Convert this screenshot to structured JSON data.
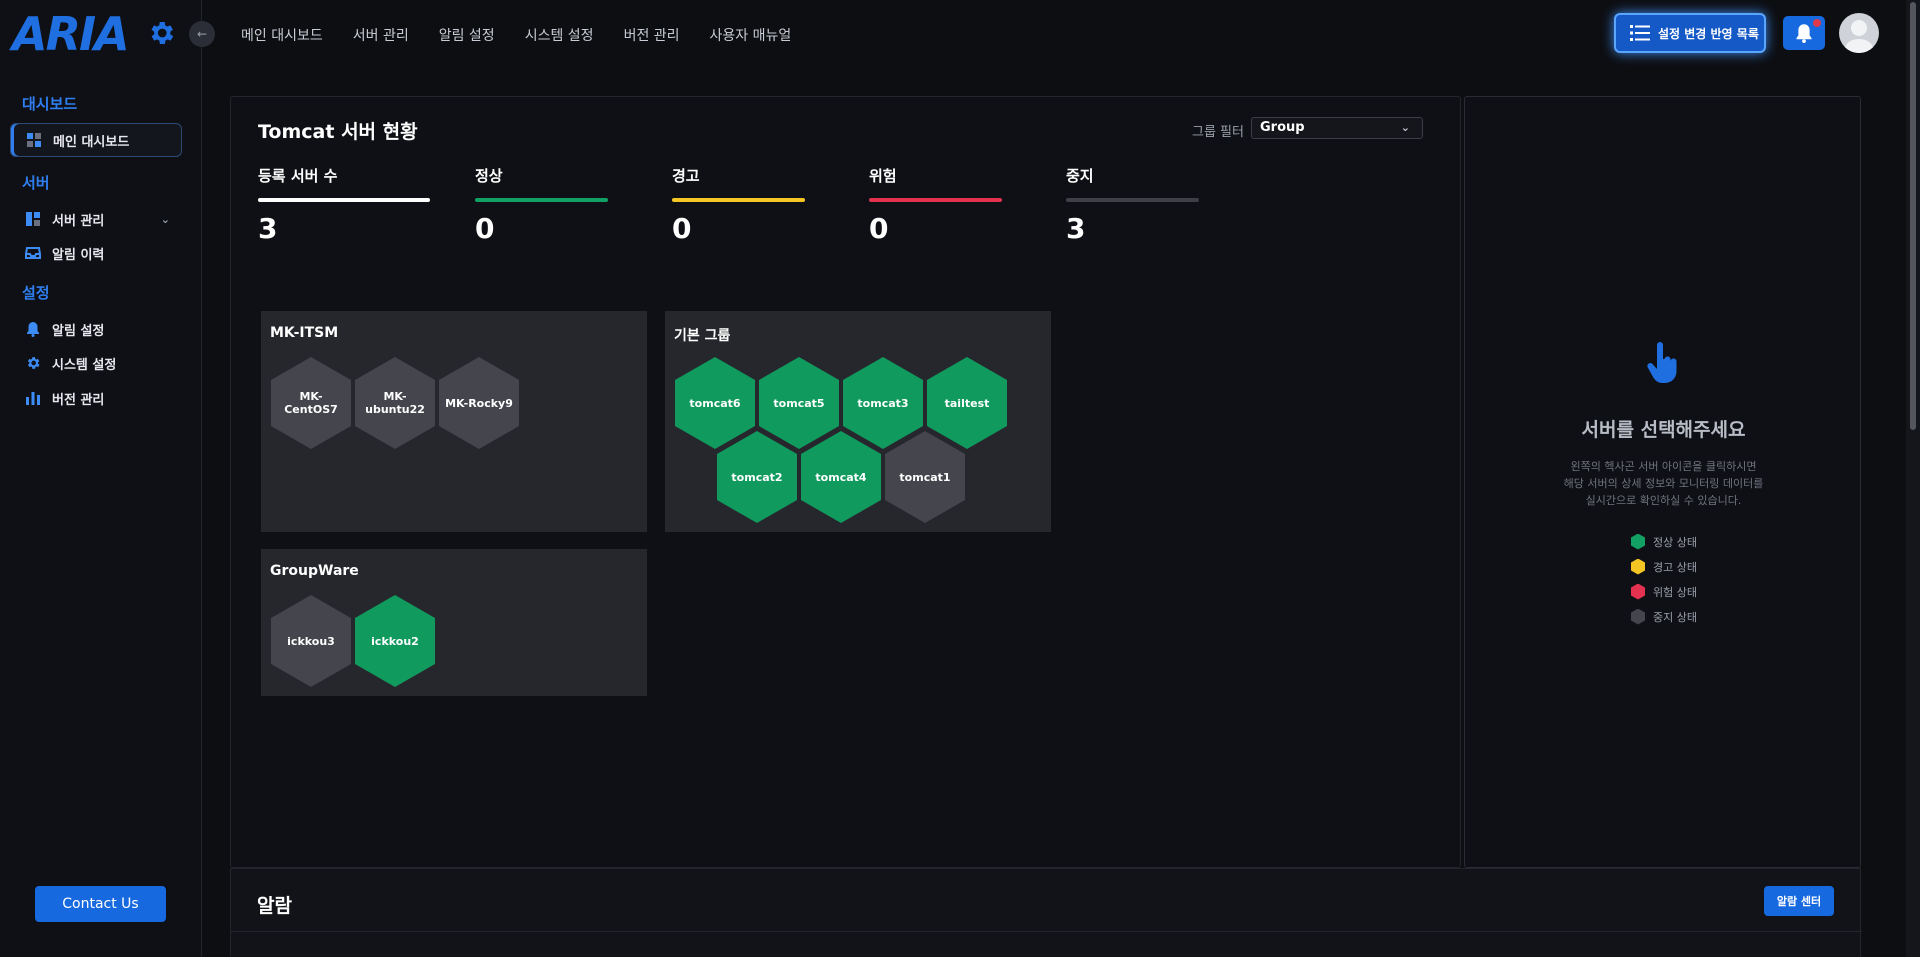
{
  "app": {
    "logo_text": "ARIA",
    "accent_color": "#1f6fe0"
  },
  "sidebar": {
    "sections": [
      {
        "label": "대시보드",
        "items": [
          {
            "label": "메인 대시보드",
            "icon": "dashboard-grid-icon",
            "active": true
          }
        ]
      },
      {
        "label": "서버",
        "items": [
          {
            "label": "서버 관리",
            "icon": "server-panel-icon",
            "has_children": true
          },
          {
            "label": "알림 이력",
            "icon": "inbox-icon"
          }
        ]
      },
      {
        "label": "설정",
        "items": [
          {
            "label": "알림 설정",
            "icon": "bell-icon"
          },
          {
            "label": "시스템 설정",
            "icon": "gear-icon"
          },
          {
            "label": "버전 관리",
            "icon": "bar-chart-icon"
          }
        ]
      }
    ],
    "contact_label": "Contact Us"
  },
  "topnav": {
    "items": [
      "메인 대시보드",
      "서버 관리",
      "알림 설정",
      "시스템 설정",
      "버전 관리",
      "사용자 매뉴얼"
    ],
    "reflect_button": "설정 변경 반영 목록"
  },
  "dashboard": {
    "title": "Tomcat 서버 현황",
    "filter_label": "그룹 필터",
    "filter_value": "Group",
    "stats": [
      {
        "label": "등록 서버 수",
        "value": "3",
        "color": "#ffffff"
      },
      {
        "label": "정상",
        "value": "0",
        "color": "#12a064"
      },
      {
        "label": "경고",
        "value": "0",
        "color": "#f3c623"
      },
      {
        "label": "위험",
        "value": "0",
        "color": "#e2324f"
      },
      {
        "label": "중지",
        "value": "3",
        "color": "#3e4048"
      }
    ],
    "groups": [
      {
        "name": "MK-ITSM",
        "servers": [
          {
            "name": "MK-CentOS7",
            "status": "stop"
          },
          {
            "name": "MK-ubuntu22",
            "status": "stop"
          },
          {
            "name": "MK-Rocky9",
            "status": "stop"
          }
        ]
      },
      {
        "name": "기본 그룹",
        "servers": [
          {
            "name": "tomcat6",
            "status": "ok"
          },
          {
            "name": "tomcat5",
            "status": "ok"
          },
          {
            "name": "tomcat3",
            "status": "ok"
          },
          {
            "name": "tailtest",
            "status": "ok"
          },
          {
            "name": "tomcat2",
            "status": "ok"
          },
          {
            "name": "tomcat4",
            "status": "ok"
          },
          {
            "name": "tomcat1",
            "status": "stop"
          }
        ]
      },
      {
        "name": "GroupWare",
        "servers": [
          {
            "name": "ickkou3",
            "status": "stop"
          },
          {
            "name": "ickkou2",
            "status": "ok"
          }
        ]
      }
    ]
  },
  "detail_panel": {
    "title": "서버를 선택해주세요",
    "description": [
      "왼쪽의 헥사곤 서버 아이콘을 클릭하시면",
      "해당 서버의 상세 정보와 모니터링 데이터를",
      "실시간으로 확인하실 수 있습니다."
    ],
    "legend": [
      {
        "label": "정상 상태",
        "color": "#12a064"
      },
      {
        "label": "경고 상태",
        "color": "#f3c623"
      },
      {
        "label": "위험 상태",
        "color": "#e2324f"
      },
      {
        "label": "중지 상태",
        "color": "#44454d"
      }
    ]
  },
  "alarm": {
    "title": "알람",
    "center_button": "알람 센터"
  }
}
